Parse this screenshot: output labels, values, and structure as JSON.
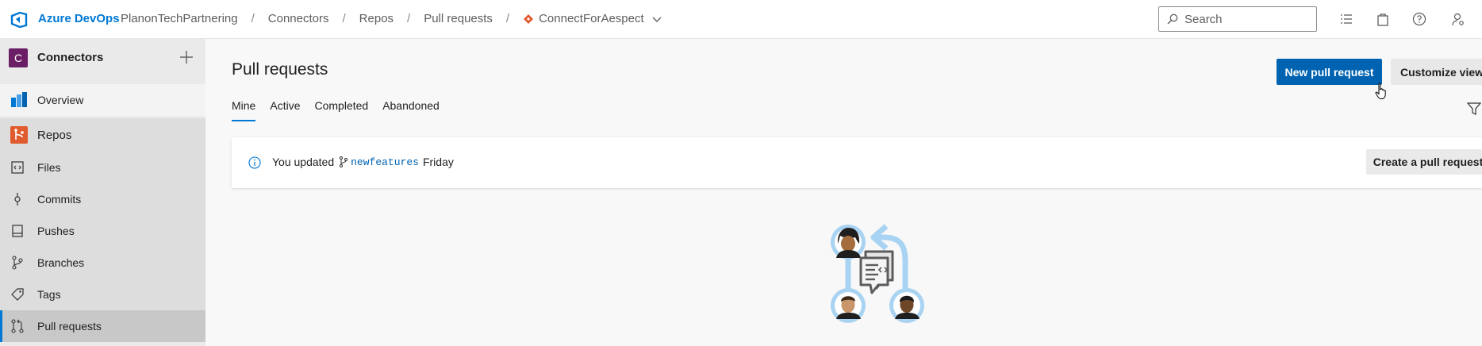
{
  "topbar": {
    "brand": "Azure DevOps",
    "breadcrumbs": [
      "PlanonTechPartnering",
      "Connectors",
      "Repos",
      "Pull requests"
    ],
    "repo_name": "ConnectForAespect",
    "search_placeholder": "Search"
  },
  "sidebar": {
    "project_initial": "C",
    "project_name": "Connectors",
    "items": [
      {
        "label": "Overview",
        "icon": "overview-icon"
      },
      {
        "label": "Repos",
        "icon": "repos-icon"
      },
      {
        "label": "Files",
        "icon": "files-icon"
      },
      {
        "label": "Commits",
        "icon": "commits-icon"
      },
      {
        "label": "Pushes",
        "icon": "pushes-icon"
      },
      {
        "label": "Branches",
        "icon": "branches-icon"
      },
      {
        "label": "Tags",
        "icon": "tags-icon"
      },
      {
        "label": "Pull requests",
        "icon": "pull-requests-icon"
      }
    ]
  },
  "main": {
    "title": "Pull requests",
    "new_pr_label": "New pull request",
    "customize_label": "Customize view",
    "tabs": [
      "Mine",
      "Active",
      "Completed",
      "Abandoned"
    ],
    "active_tab": "Mine",
    "banner": {
      "prefix": "You updated",
      "branch": "newfeatures",
      "suffix": "Friday",
      "create_label": "Create a pull request"
    }
  },
  "colors": {
    "accent": "#0078d4",
    "primary_button": "#0063b1",
    "project_avatar": "#6b1e65",
    "repos_icon": "#e05b2d"
  }
}
